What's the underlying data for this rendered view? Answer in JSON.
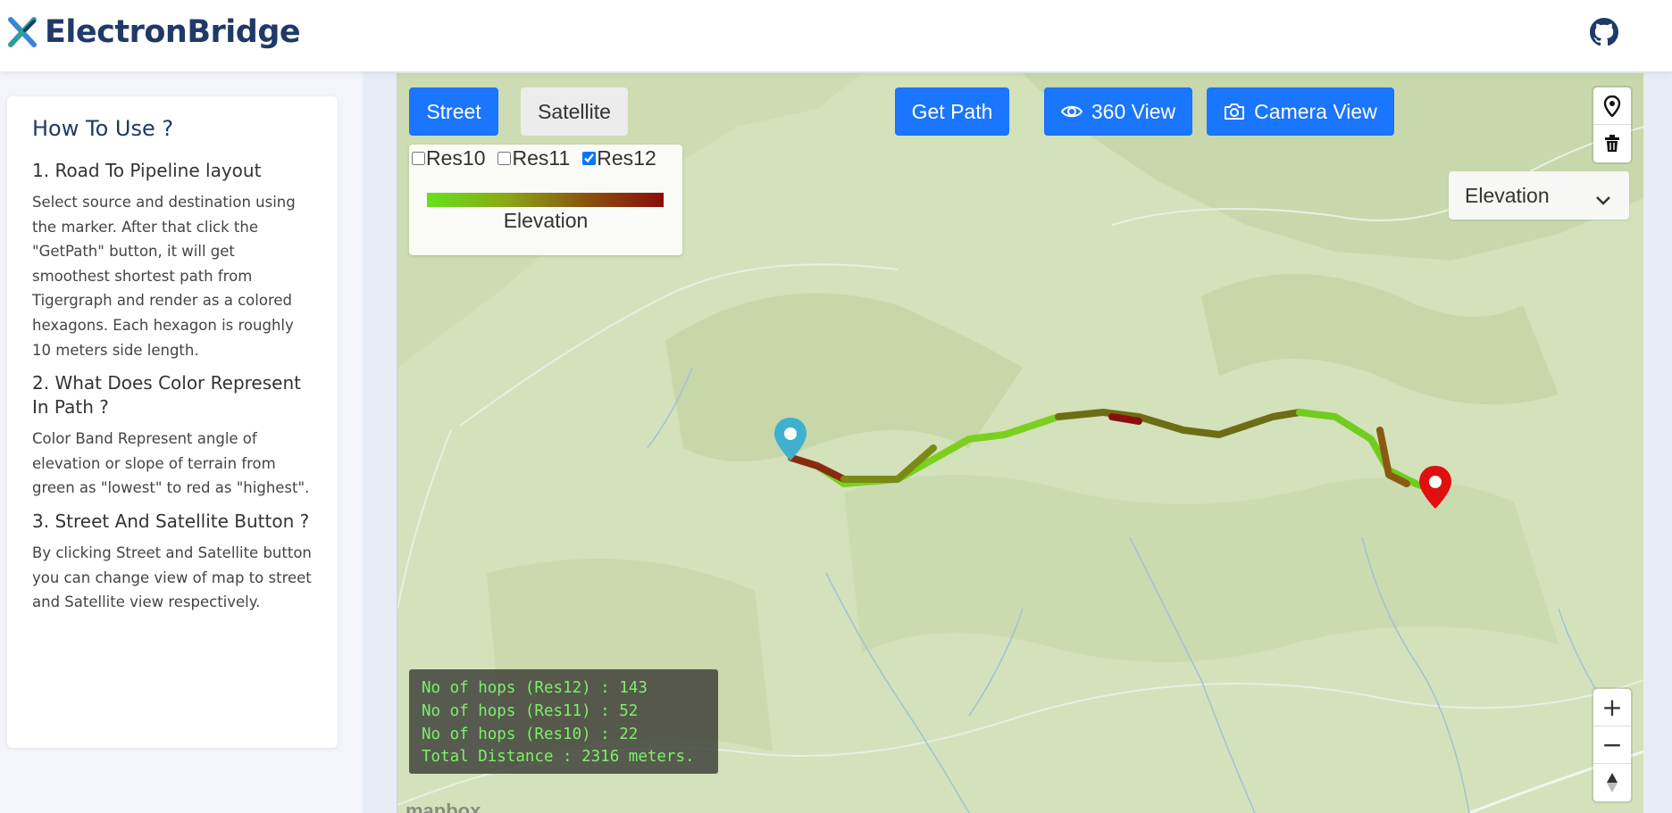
{
  "header": {
    "brand": "ElectronBridge",
    "logo_icon": "electron-bridge-logo-icon",
    "github_icon": "github-icon"
  },
  "how_to": {
    "title": "How To Use ?",
    "sections": [
      {
        "heading": "1. Road To Pipeline layout",
        "body": "Select source and destination using the marker. After that click the \"GetPath\" button, it will get smoothest shortest path from Tigergraph and render as a colored hexagons. Each hexagon is roughly 10 meters side length."
      },
      {
        "heading": "2. What Does Color Represent In Path ?",
        "body": "Color Band Represent angle of elevation or slope of terrain from green as \"lowest\" to red as \"highest\"."
      },
      {
        "heading": "3. Street And Satellite Button ?",
        "body": "By clicking Street and Satellite button you can change view of map to street and Satellite view respectively."
      }
    ]
  },
  "map_toolbar": {
    "street": "Street",
    "satellite": "Satellite",
    "get_path": "Get Path",
    "view_360": "360 View",
    "camera_view": "Camera View"
  },
  "legend": {
    "resolutions": [
      {
        "label": "Res10",
        "checked": false
      },
      {
        "label": "Res11",
        "checked": false
      },
      {
        "label": "Res12",
        "checked": true
      }
    ],
    "label": "Elevation",
    "gradient_colors": [
      "#66e11c",
      "#8aa818",
      "#8a5410",
      "#8a0c0c"
    ]
  },
  "layer_select": {
    "value": "Elevation"
  },
  "map_controls": {
    "zoom_in": "+",
    "zoom_out": "−",
    "compass_icon": "compass-icon",
    "marker_tool_icon": "map-marker-icon",
    "trash_tool_icon": "trash-icon"
  },
  "stats": {
    "line1": "No of hops (Res12) : 143",
    "line2": "No of hops (Res11) : 52",
    "line3": "No of hops (Res10) : 22",
    "line4": "Total Distance : 2316 meters."
  },
  "attribution": {
    "mapbox": "mapbox"
  },
  "colors": {
    "primary": "#1a75ff",
    "brand_text": "#1f3a68",
    "map_bg": "#d6e4bf",
    "start_marker": "#3fb1ce",
    "end_marker": "#e01010"
  }
}
